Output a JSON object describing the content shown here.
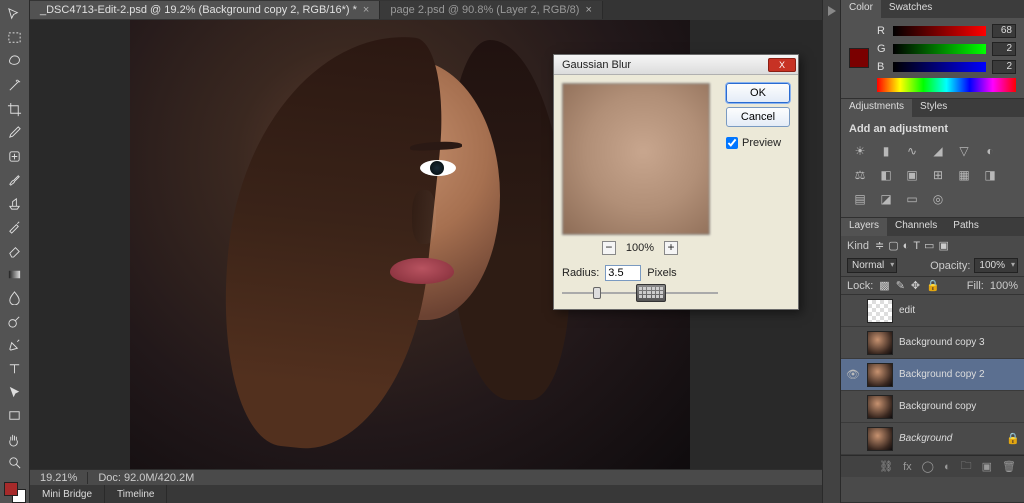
{
  "tabs": [
    {
      "label": "_DSC4713-Edit-2.psd @ 19.2% (Background copy 2, RGB/16*) *",
      "active": true
    },
    {
      "label": "page 2.psd @ 90.8% (Layer 2, RGB/8)",
      "active": false
    }
  ],
  "tools": [
    "move",
    "rect-marquee",
    "lasso",
    "magic-wand",
    "crop",
    "eyedropper",
    "spot-heal",
    "brush",
    "clone-stamp",
    "history-brush",
    "eraser",
    "gradient",
    "blur",
    "dodge",
    "pen",
    "type",
    "path-select",
    "rectangle",
    "hand",
    "zoom"
  ],
  "status": {
    "zoom": "19.21%",
    "doc": "Doc: 92.0M/420.2M"
  },
  "footer_tabs": [
    "Mini Bridge",
    "Timeline"
  ],
  "color_panel": {
    "tabs": [
      "Color",
      "Swatches"
    ],
    "swatch": "#7a0000",
    "channels": [
      {
        "name": "R",
        "value": "68"
      },
      {
        "name": "G",
        "value": "2"
      },
      {
        "name": "B",
        "value": "2"
      }
    ]
  },
  "adjustments": {
    "tabs": [
      "Adjustments",
      "Styles"
    ],
    "heading": "Add an adjustment"
  },
  "layers_panel": {
    "tabs": [
      "Layers",
      "Channels",
      "Paths"
    ],
    "kind_label": "Kind",
    "blend_mode": "Normal",
    "opacity_label": "Opacity:",
    "opacity_value": "100%",
    "lock_label": "Lock:",
    "fill_label": "Fill:",
    "fill_value": "100%",
    "layers": [
      {
        "name": "edit",
        "thumb": "checker",
        "visible": false,
        "italic": false,
        "locked": false
      },
      {
        "name": "Background copy 3",
        "thumb": "photo",
        "visible": false,
        "italic": false,
        "locked": false
      },
      {
        "name": "Background copy 2",
        "thumb": "photo",
        "visible": true,
        "italic": false,
        "locked": false,
        "selected": true
      },
      {
        "name": "Background copy",
        "thumb": "photo",
        "visible": false,
        "italic": false,
        "locked": false
      },
      {
        "name": "Background",
        "thumb": "photo",
        "visible": false,
        "italic": true,
        "locked": true
      }
    ]
  },
  "dialog": {
    "title": "Gaussian Blur",
    "ok": "OK",
    "cancel": "Cancel",
    "preview_label": "Preview",
    "preview_checked": true,
    "zoom_pct": "100%",
    "radius_label": "Radius:",
    "radius_value": "3.5",
    "radius_unit": "Pixels"
  }
}
